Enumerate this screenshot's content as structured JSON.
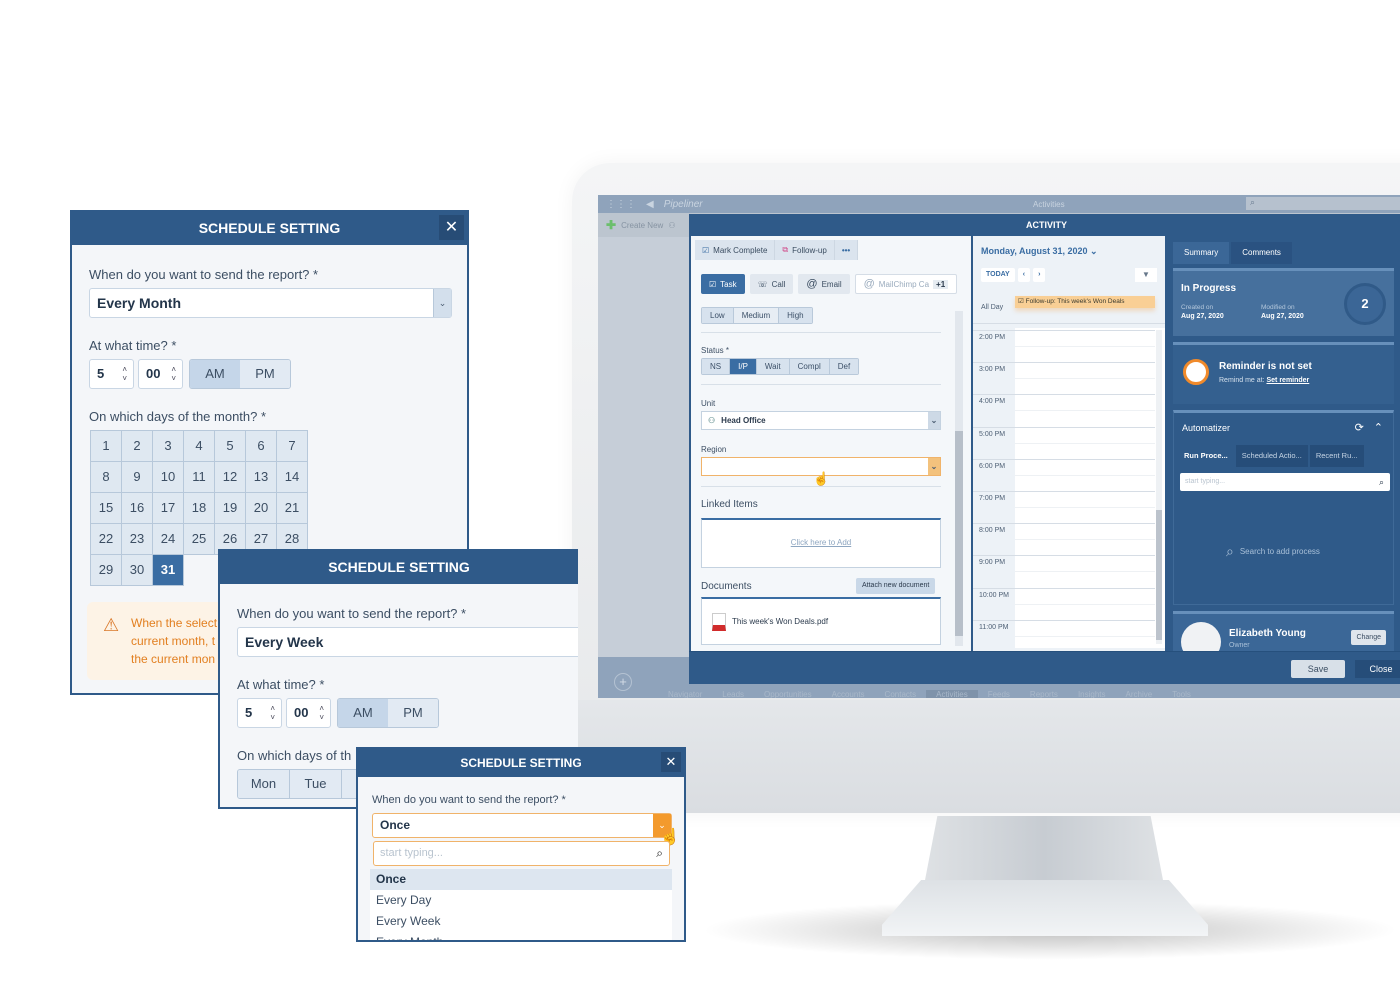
{
  "app": {
    "brand": "Pipeliner",
    "section_title": "Activities",
    "create_new": "Create New",
    "bottom_nav": [
      "Navigator",
      "Leads",
      "Opportunities",
      "Accounts",
      "Contacts",
      "Activities",
      "Feeds",
      "Reports",
      "Insights",
      "Archive",
      "Tools"
    ],
    "active_nav": "Activities"
  },
  "activity": {
    "title": "ACTIVITY",
    "toolbar": {
      "mark_complete": "Mark Complete",
      "follow_up": "Follow-up",
      "more": "•••"
    },
    "types": [
      {
        "label": "Task",
        "active": true
      },
      {
        "label": "Call",
        "active": false
      },
      {
        "label": "Email",
        "active": false
      },
      {
        "label": "MailChimp Ca",
        "active": false
      }
    ],
    "types_extra": "+1",
    "priority": [
      "Low",
      "Medium",
      "High"
    ],
    "status_label": "Status *",
    "statuses": [
      "NS",
      "I/P",
      "Wait",
      "Compl",
      "Def"
    ],
    "status_selected": "I/P",
    "unit_label": "Unit",
    "unit_value": "Head Office",
    "region_label": "Region",
    "region_value": "",
    "linked_label": "Linked Items",
    "linked_action": "Click here to Add",
    "documents_label": "Documents",
    "attach_label": "Attach new document",
    "document_file": "This week's Won Deals.pdf",
    "calendar": {
      "date": "Monday, August 31, 2020",
      "today": "TODAY",
      "all_day": "All Day",
      "event": "Follow-up: This week's Won Deals",
      "times": [
        "2:00 PM",
        "3:00 PM",
        "4:00 PM",
        "5:00 PM",
        "6:00 PM",
        "7:00 PM",
        "8:00 PM",
        "9:00 PM",
        "10:00 PM",
        "11:00 PM"
      ]
    },
    "side_tabs": [
      "Summary",
      "Comments"
    ],
    "summary": {
      "state": "In Progress",
      "created_label": "Created on",
      "created": "Aug 27, 2020",
      "modified_label": "Modified on",
      "modified": "Aug 27, 2020",
      "count": "2"
    },
    "reminder": {
      "title": "Reminder is not set",
      "prefix": "Remind me at:",
      "link": "Set reminder"
    },
    "automatizer": {
      "title": "Automatizer",
      "tabs": [
        "Run Proce...",
        "Scheduled Actio...",
        "Recent Ru..."
      ],
      "placeholder": "start typing...",
      "empty": "Search to add process"
    },
    "owner": {
      "name": "Elizabeth Young",
      "role": "Owner",
      "change": "Change"
    },
    "save": "Save",
    "close": "Close"
  },
  "dialogs": {
    "monthly": {
      "title": "SCHEDULE SETTING",
      "question": "When do you want to send the report? *",
      "frequency": "Every Month",
      "time_label": "At what time? *",
      "hour": "5",
      "minute": "00",
      "am": "AM",
      "pm": "PM",
      "days_label": "On which days of the month? *",
      "days": [
        "1",
        "2",
        "3",
        "4",
        "5",
        "6",
        "7",
        "8",
        "9",
        "10",
        "11",
        "12",
        "13",
        "14",
        "15",
        "16",
        "17",
        "18",
        "19",
        "20",
        "21",
        "22",
        "23",
        "24",
        "25",
        "26",
        "27",
        "28",
        "29",
        "30",
        "31"
      ],
      "selected_day": "31",
      "warning": [
        "When the select",
        "current month, t",
        "the current mon"
      ]
    },
    "weekly": {
      "title": "SCHEDULE SETTING",
      "question": "When do you want to send the report? *",
      "frequency": "Every Week",
      "time_label": "At what time? *",
      "hour": "5",
      "minute": "00",
      "am": "AM",
      "pm": "PM",
      "days_label": "On which days of th",
      "weekdays": [
        "Mon",
        "Tue"
      ]
    },
    "once": {
      "title": "SCHEDULE SETTING",
      "question": "When do you want to send the report? *",
      "frequency": "Once",
      "search_placeholder": "start typing...",
      "options": [
        "Once",
        "Every Day",
        "Every Week",
        "Every Month"
      ],
      "highlighted": "Once"
    }
  },
  "colors": {
    "primary": "#2f5a89",
    "accent": "#3a6da3",
    "warning": "#e27f20",
    "highlight": "#f3c27d"
  }
}
